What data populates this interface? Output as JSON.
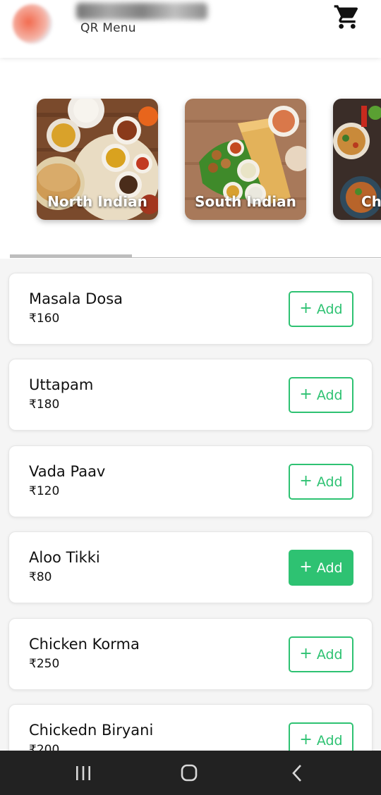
{
  "header": {
    "subtitle": "QR Menu",
    "cart_icon": "shopping-cart-icon"
  },
  "categories": [
    {
      "label": "North Indian"
    },
    {
      "label": "South Indian"
    },
    {
      "label": "Ch"
    }
  ],
  "menu": {
    "add_label": "Add",
    "items": [
      {
        "name": "Masala Dosa",
        "price": "₹160"
      },
      {
        "name": "Uttapam",
        "price": "₹180"
      },
      {
        "name": "Vada Paav",
        "price": "₹120"
      },
      {
        "name": "Aloo Tikki",
        "price": "₹80"
      },
      {
        "name": "Chicken Korma",
        "price": "₹250"
      },
      {
        "name": "Chickedn Biryani",
        "price": "₹200"
      }
    ]
  },
  "colors": {
    "accent_green": "#2ec272",
    "navbar": "#222222"
  },
  "navbar": {
    "icons": [
      "recent-apps-icon",
      "home-icon",
      "back-icon"
    ]
  }
}
